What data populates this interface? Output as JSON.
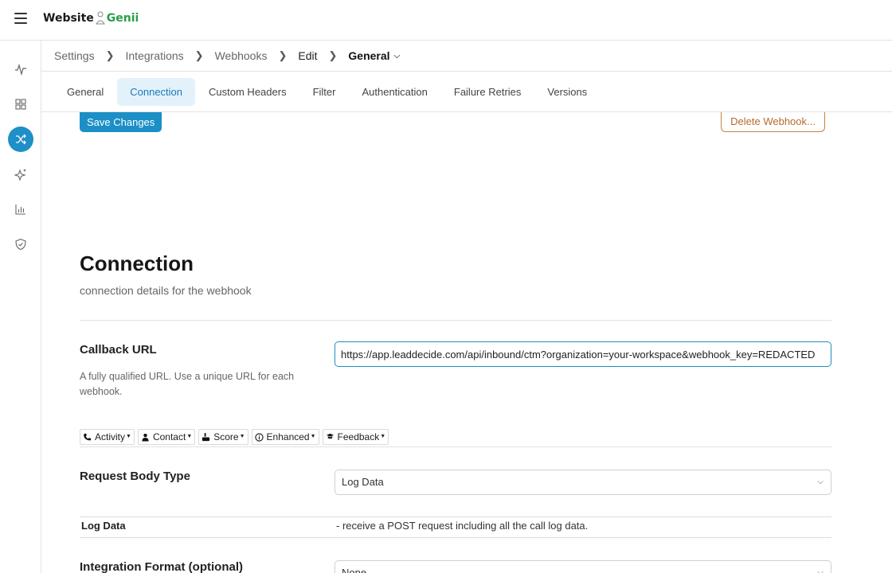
{
  "app": {
    "logo_word": "Website",
    "logo_accent": "Genii"
  },
  "rail": {
    "items": [
      {
        "icon": "activity-icon",
        "label": "Activity"
      },
      {
        "icon": "grid-icon",
        "label": "Dashboard"
      },
      {
        "icon": "shuffle-icon",
        "label": "Integrations",
        "active": true
      },
      {
        "icon": "sparkle-icon",
        "label": "AI"
      },
      {
        "icon": "chart-icon",
        "label": "Reports"
      },
      {
        "icon": "shield-icon",
        "label": "Security"
      }
    ],
    "accent": "#1e8fc7"
  },
  "breadcrumb": {
    "items": [
      "Settings",
      "Integrations",
      "Webhooks",
      "Edit"
    ],
    "current": "General"
  },
  "tabs": {
    "items": [
      "General",
      "Connection",
      "Custom Headers",
      "Filter",
      "Authentication",
      "Failure Retries",
      "Versions"
    ],
    "active": "Connection"
  },
  "actions": {
    "save_label": "Save Changes",
    "delete_label": "Delete Webhook..."
  },
  "section": {
    "title": "Connection",
    "subtitle": "connection details for the webhook"
  },
  "callback": {
    "label": "Callback URL",
    "help": "A fully qualified URL. Use a unique URL for each webhook.",
    "value": "https://app.leaddecide.com/api/inbound/ctm?organization=your-workspace&webhook_key=REDACTED"
  },
  "pills": [
    {
      "icon": "phone-icon",
      "label": "Activity"
    },
    {
      "icon": "person-icon",
      "label": "Contact"
    },
    {
      "icon": "score-icon",
      "label": "Score"
    },
    {
      "icon": "info-icon",
      "label": "Enhanced"
    },
    {
      "icon": "feedback-icon",
      "label": "Feedback"
    }
  ],
  "request_body": {
    "label": "Request Body Type",
    "selected": "Log Data",
    "desc_term": "Log Data",
    "desc_text": "- receive a POST request including all the call log data."
  },
  "integration_format": {
    "label": "Integration Format (optional)",
    "selected": "None"
  }
}
